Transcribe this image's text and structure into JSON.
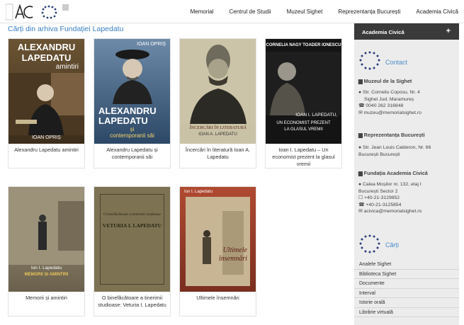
{
  "nav": {
    "items": [
      "Memorial",
      "Centrul de Studii",
      "Muzeul Sighet",
      "Reprezentanța București",
      "Academia Civică"
    ]
  },
  "page_title": "Cărți din arhiva Fundației Lapedatu",
  "books": [
    {
      "title": "Alexandru Lapedatu amintiri",
      "cover": {
        "line1": "ALEXANDRU",
        "line2": "LAPEDATU",
        "line3": "amintiri",
        "author": "IOAN OPRIȘ"
      }
    },
    {
      "title": "Alexandru Lapedatu și contemporanii săi",
      "cover": {
        "line1": "IOAN OPRIȘ",
        "line2": "ALEXANDRU",
        "line3": "LAPEDATU",
        "line4": "și",
        "line5": "contemporanii săi"
      }
    },
    {
      "title": "Încercări în literatură Ioan A. Lapedatu",
      "cover": {
        "line1": "ÎNCERCĂRI ÎN LITERATURĂ",
        "line2": "IOAN A. LAPEDATU"
      }
    },
    {
      "title": "Ioan I. Lapedatu – Un economist prezent la glasul vremii",
      "cover": {
        "line1": "CORNELIA NAGY  TOADER IONESCU",
        "line2": "IOAN I. LAPEDATU,",
        "line3": "UN ECONOMIST PREZENT",
        "line4": "LA GLASUL VREMII"
      }
    },
    {
      "title": "Memorii și amintiri",
      "cover": {
        "line1": "Ion I. Lapedatu",
        "line2": "MEMORII ȘI AMINTIRI"
      }
    },
    {
      "title": "O binefăcătoare a tinerimii studioase: Veturia I. Lapedatu",
      "cover": {
        "line1": "O binefăcătoare a tinerimii studioase",
        "line2": "VETURIA I. LAPEDATU"
      }
    },
    {
      "title": "Ultimele însemnări",
      "cover": {
        "line1": "Ion I. Lapedatu",
        "line2": "Ultimele",
        "line3": "însemnări"
      }
    }
  ],
  "sidebar": {
    "tab_label": "Academia Civică",
    "tab_plus": "+",
    "contact_heading": "Contact",
    "orgs": [
      {
        "name": "Muzeul de la Sighet",
        "lines": [
          "Str. Corneliu Coposu, Nr. 4",
          "Sighet Jud. Maramureș",
          "0040 262 316848",
          "muzeu@memorialsighet.ro"
        ]
      },
      {
        "name": "Reprezentanța București",
        "lines": [
          "Str. Jean Louis Calderon, Nr. 66",
          "București București"
        ]
      },
      {
        "name": "Fundația Academia Civică",
        "lines": [
          "Calea Moșilor nr. 132, etaj I",
          "București Sector 2",
          "+40-21-3129852",
          "+40-21-3125854",
          "acivica@memorialsighet.ro"
        ]
      }
    ],
    "books_heading": "Cărți",
    "book_links": [
      "Analele Sighet",
      "Biblioteca Sighet",
      "Documente",
      "Interval",
      "Istorie orală",
      "Librărie virtuală"
    ]
  },
  "colors": {
    "accent": "#3a7fc4",
    "sidebar_bg": "#ececec",
    "tab_bg": "#3a3a3a"
  }
}
